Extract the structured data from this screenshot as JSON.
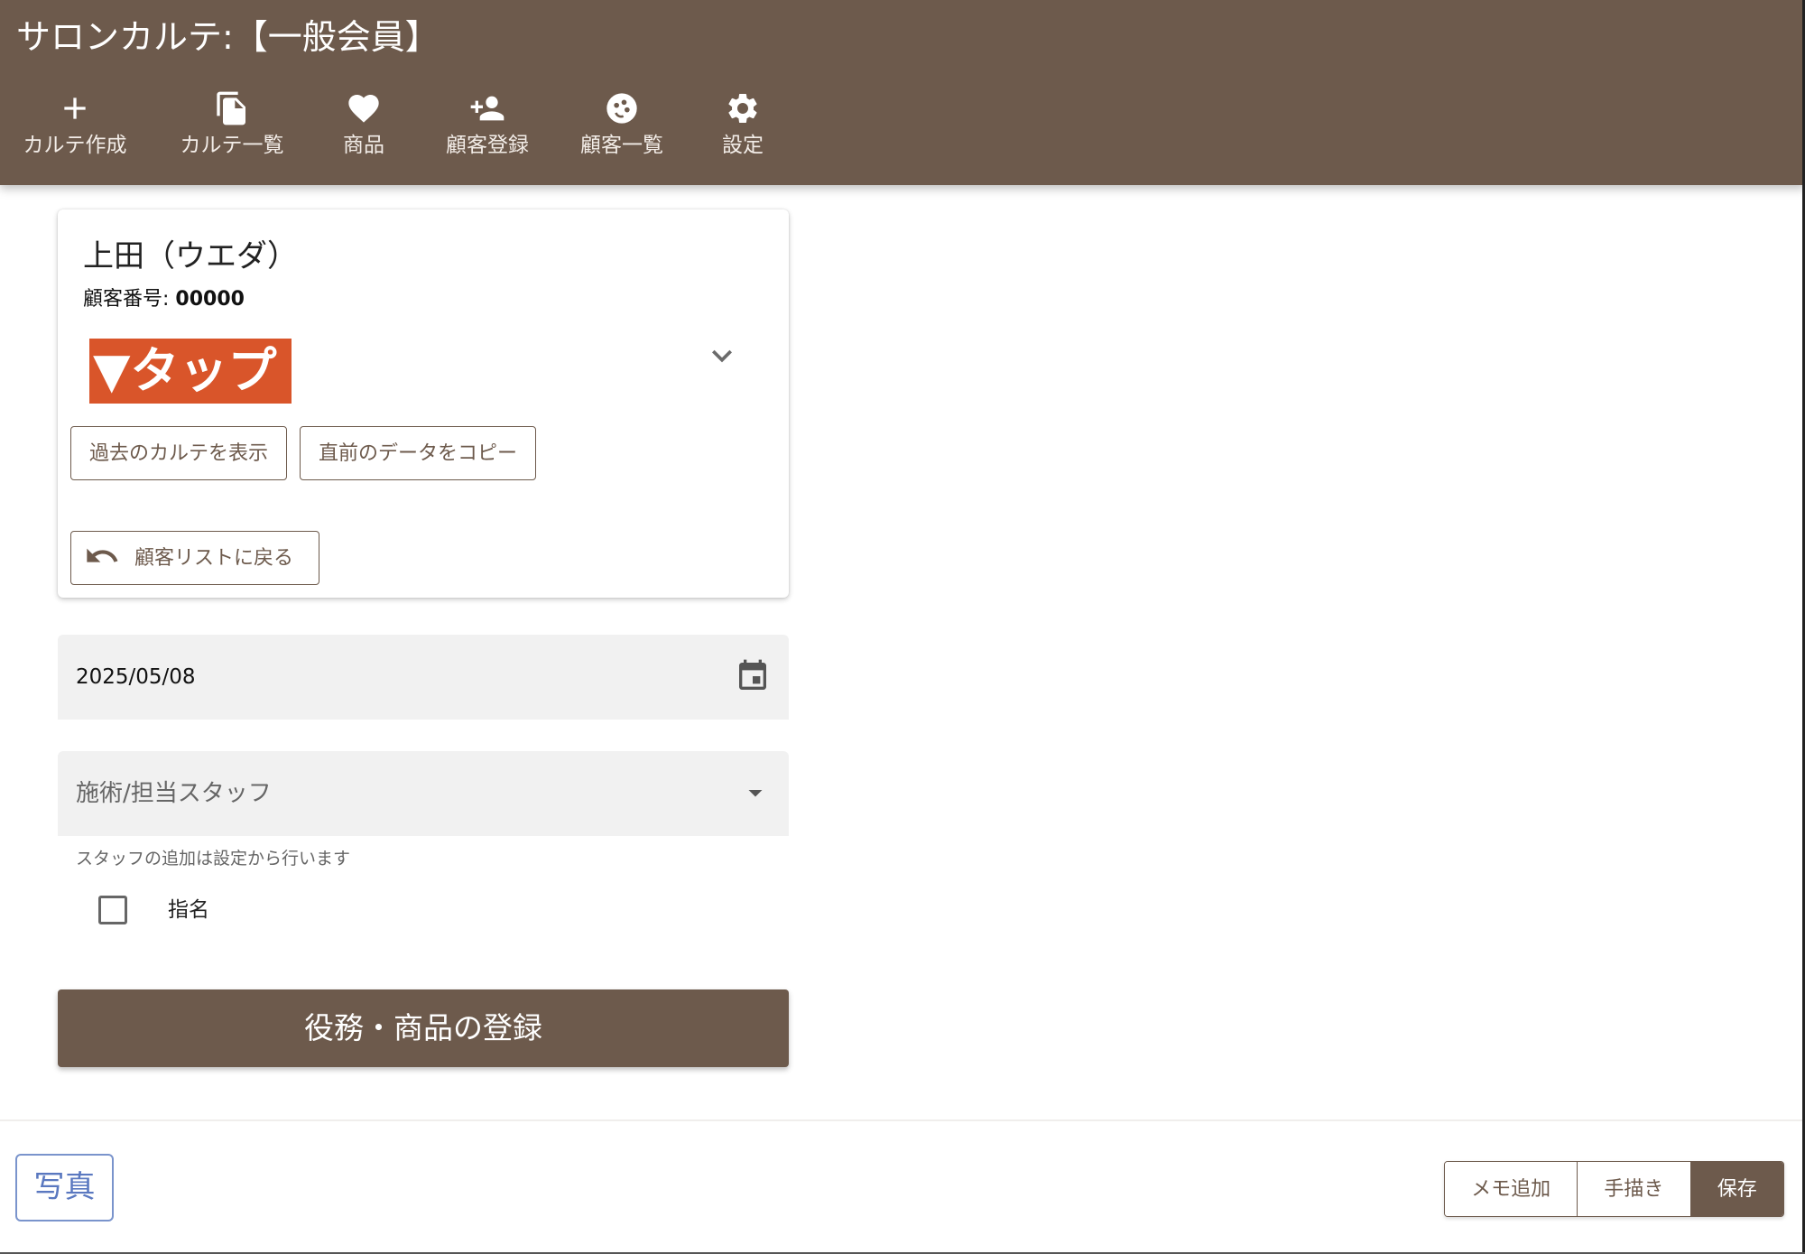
{
  "app": {
    "title": "サロンカルテ:【一般会員】"
  },
  "nav": [
    {
      "label": "カルテ作成",
      "icon": "plus-icon"
    },
    {
      "label": "カルテ一覧",
      "icon": "copy-icon"
    },
    {
      "label": "商品",
      "icon": "heart-icon"
    },
    {
      "label": "顧客登録",
      "icon": "person-add-icon"
    },
    {
      "label": "顧客一覧",
      "icon": "face-icon"
    },
    {
      "label": "設定",
      "icon": "gear-icon"
    }
  ],
  "customer": {
    "name": "上田（ウエダ）",
    "number_label": "顧客番号:",
    "number": "00000",
    "tap_label": "▼タップ",
    "past_button": "過去のカルテを表示",
    "copy_button": "直前のデータをコピー",
    "back_button": "顧客リストに戻る"
  },
  "form": {
    "date": "2025/05/08",
    "staff_placeholder": "施術/担当スタッフ",
    "staff_helper": "スタッフの追加は設定から行います",
    "nomination_label": "指名",
    "nomination_checked": false,
    "register_button": "役務・商品の登録"
  },
  "bottom": {
    "photo_button": "写真",
    "memo_button": "メモ追加",
    "draw_button": "手描き",
    "save_button": "保存"
  },
  "colors": {
    "brand": "#6d5a4c",
    "accent_tap": "#d9552a",
    "photo_blue": "#5a78c0"
  }
}
